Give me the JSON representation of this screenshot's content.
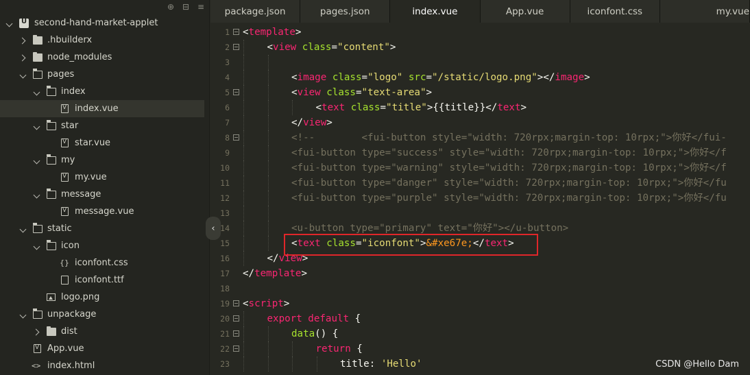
{
  "sidebar": {
    "toolbar": [
      {
        "name": "locate-icon",
        "glyph": "⊕"
      },
      {
        "name": "collapse-all-icon",
        "glyph": "⊟"
      },
      {
        "name": "menu-icon",
        "glyph": "≡"
      }
    ],
    "tree": [
      {
        "label": "second-hand-market-applet",
        "depth": 0,
        "kind": "project",
        "caret": "open"
      },
      {
        "label": ".hbuilderx",
        "depth": 1,
        "kind": "folder",
        "caret": "closed"
      },
      {
        "label": "node_modules",
        "depth": 1,
        "kind": "folder",
        "caret": "closed"
      },
      {
        "label": "pages",
        "depth": 1,
        "kind": "folder-open",
        "caret": "open"
      },
      {
        "label": "index",
        "depth": 2,
        "kind": "folder-open",
        "caret": "open"
      },
      {
        "label": "index.vue",
        "depth": 3,
        "kind": "vue",
        "caret": "none",
        "selected": true
      },
      {
        "label": "star",
        "depth": 2,
        "kind": "folder-open",
        "caret": "open"
      },
      {
        "label": "star.vue",
        "depth": 3,
        "kind": "vue",
        "caret": "none"
      },
      {
        "label": "my",
        "depth": 2,
        "kind": "folder-open",
        "caret": "open"
      },
      {
        "label": "my.vue",
        "depth": 3,
        "kind": "vue",
        "caret": "none"
      },
      {
        "label": "message",
        "depth": 2,
        "kind": "folder-open",
        "caret": "open"
      },
      {
        "label": "message.vue",
        "depth": 3,
        "kind": "vue",
        "caret": "none"
      },
      {
        "label": "static",
        "depth": 1,
        "kind": "folder-open",
        "caret": "open"
      },
      {
        "label": "icon",
        "depth": 2,
        "kind": "folder-open",
        "caret": "open"
      },
      {
        "label": "iconfont.css",
        "depth": 3,
        "kind": "css",
        "caret": "none"
      },
      {
        "label": "iconfont.ttf",
        "depth": 3,
        "kind": "plain",
        "caret": "none"
      },
      {
        "label": "logo.png",
        "depth": 2,
        "kind": "img",
        "caret": "none"
      },
      {
        "label": "unpackage",
        "depth": 1,
        "kind": "folder-open",
        "caret": "open"
      },
      {
        "label": "dist",
        "depth": 2,
        "kind": "folder",
        "caret": "closed"
      },
      {
        "label": "App.vue",
        "depth": 1,
        "kind": "vue",
        "caret": "none"
      },
      {
        "label": "index.html",
        "depth": 1,
        "kind": "html",
        "caret": "none"
      }
    ],
    "collapse_handle_glyph": "‹"
  },
  "tabs": [
    {
      "label": "package.json",
      "active": false
    },
    {
      "label": "pages.json",
      "active": false
    },
    {
      "label": "index.vue",
      "active": true
    },
    {
      "label": "App.vue",
      "active": false
    },
    {
      "label": "iconfont.css",
      "active": false
    },
    {
      "label": "my.vue",
      "active": false
    }
  ],
  "editor": {
    "lines": [
      {
        "n": "1",
        "fold": true,
        "indent": 0,
        "tokens": [
          [
            "t-punc",
            "<"
          ],
          [
            "t-tag",
            "template"
          ],
          [
            "t-punc",
            ">"
          ]
        ]
      },
      {
        "n": "2",
        "fold": true,
        "indent": 1,
        "tokens": [
          [
            "t-punc",
            "<"
          ],
          [
            "t-tag",
            "view"
          ],
          [
            "t-punc",
            " "
          ],
          [
            "t-attr",
            "class"
          ],
          [
            "t-punc",
            "="
          ],
          [
            "t-str",
            "\"content\""
          ],
          [
            "t-punc",
            ">"
          ]
        ]
      },
      {
        "n": "3",
        "fold": false,
        "indent": 2,
        "tokens": []
      },
      {
        "n": "4",
        "fold": false,
        "indent": 2,
        "tokens": [
          [
            "t-punc",
            "<"
          ],
          [
            "t-tag",
            "image"
          ],
          [
            "t-punc",
            " "
          ],
          [
            "t-attr",
            "class"
          ],
          [
            "t-punc",
            "="
          ],
          [
            "t-str",
            "\"logo\""
          ],
          [
            "t-punc",
            " "
          ],
          [
            "t-attr",
            "src"
          ],
          [
            "t-punc",
            "="
          ],
          [
            "t-str",
            "\"/static/logo.png\""
          ],
          [
            "t-punc",
            "></"
          ],
          [
            "t-tag",
            "image"
          ],
          [
            "t-punc",
            ">"
          ]
        ]
      },
      {
        "n": "5",
        "fold": true,
        "indent": 2,
        "tokens": [
          [
            "t-punc",
            "<"
          ],
          [
            "t-tag",
            "view"
          ],
          [
            "t-punc",
            " "
          ],
          [
            "t-attr",
            "class"
          ],
          [
            "t-punc",
            "="
          ],
          [
            "t-str",
            "\"text-area\""
          ],
          [
            "t-punc",
            ">"
          ]
        ]
      },
      {
        "n": "6",
        "fold": false,
        "indent": 3,
        "tokens": [
          [
            "t-punc",
            "<"
          ],
          [
            "t-tag",
            "text"
          ],
          [
            "t-punc",
            " "
          ],
          [
            "t-attr",
            "class"
          ],
          [
            "t-punc",
            "="
          ],
          [
            "t-str",
            "\"title\""
          ],
          [
            "t-punc",
            ">{{title}}</"
          ],
          [
            "t-tag",
            "text"
          ],
          [
            "t-punc",
            ">"
          ]
        ]
      },
      {
        "n": "7",
        "fold": false,
        "indent": 2,
        "tokens": [
          [
            "t-punc",
            "</"
          ],
          [
            "t-tag",
            "view"
          ],
          [
            "t-punc",
            ">"
          ]
        ]
      },
      {
        "n": "8",
        "fold": true,
        "indent": 2,
        "tokens": [
          [
            "t-comment",
            "<!--        <fui-button style=\"width: 720rpx;margin-top: 10rpx;\">你好</fui-"
          ]
        ]
      },
      {
        "n": "9",
        "fold": false,
        "indent": 2,
        "tokens": [
          [
            "t-comment",
            "<fui-button type=\"success\" style=\"width: 720rpx;margin-top: 10rpx;\">你好</f"
          ]
        ]
      },
      {
        "n": "10",
        "fold": false,
        "indent": 2,
        "tokens": [
          [
            "t-comment",
            "<fui-button type=\"warning\" style=\"width: 720rpx;margin-top: 10rpx;\">你好</f"
          ]
        ]
      },
      {
        "n": "11",
        "fold": false,
        "indent": 2,
        "tokens": [
          [
            "t-comment",
            "<fui-button type=\"danger\" style=\"width: 720rpx;margin-top: 10rpx;\">你好</fu"
          ]
        ]
      },
      {
        "n": "12",
        "fold": false,
        "indent": 2,
        "tokens": [
          [
            "t-comment",
            "<fui-button type=\"purple\" style=\"width: 720rpx;margin-top: 10rpx;\">你好</fu"
          ]
        ]
      },
      {
        "n": "13",
        "fold": false,
        "indent": 2,
        "tokens": []
      },
      {
        "n": "14",
        "fold": false,
        "indent": 2,
        "tokens": [
          [
            "t-comment",
            "<u-button type=\"primary\" text=\"你好\"></u-button>"
          ]
        ]
      },
      {
        "n": "15",
        "fold": false,
        "indent": 2,
        "tokens": [
          [
            "t-punc",
            "<"
          ],
          [
            "t-tag",
            "text"
          ],
          [
            "t-punc",
            " "
          ],
          [
            "t-attr",
            "class"
          ],
          [
            "t-punc",
            "="
          ],
          [
            "t-str",
            "\"iconfont\""
          ],
          [
            "t-punc",
            ">"
          ],
          [
            "t-ent",
            "&#xe67e;"
          ],
          [
            "t-punc",
            "</"
          ],
          [
            "t-tag",
            "text"
          ],
          [
            "t-punc",
            ">"
          ]
        ]
      },
      {
        "n": "16",
        "fold": false,
        "indent": 1,
        "tokens": [
          [
            "t-punc",
            "</"
          ],
          [
            "t-tag",
            "view"
          ],
          [
            "t-punc",
            ">"
          ]
        ]
      },
      {
        "n": "17",
        "fold": false,
        "indent": 0,
        "tokens": [
          [
            "t-punc",
            "</"
          ],
          [
            "t-tag",
            "template"
          ],
          [
            "t-punc",
            ">"
          ]
        ]
      },
      {
        "n": "18",
        "fold": false,
        "indent": 0,
        "tokens": []
      },
      {
        "n": "19",
        "fold": true,
        "indent": 0,
        "tokens": [
          [
            "t-punc",
            "<"
          ],
          [
            "t-tag",
            "script"
          ],
          [
            "t-punc",
            ">"
          ]
        ]
      },
      {
        "n": "20",
        "fold": true,
        "indent": 1,
        "tokens": [
          [
            "t-kw",
            "export"
          ],
          [
            "t-punc",
            " "
          ],
          [
            "t-kw",
            "default"
          ],
          [
            "t-punc",
            " {"
          ]
        ]
      },
      {
        "n": "21",
        "fold": true,
        "indent": 2,
        "tokens": [
          [
            "t-fn",
            "data"
          ],
          [
            "t-punc",
            "() {"
          ]
        ]
      },
      {
        "n": "22",
        "fold": true,
        "indent": 3,
        "tokens": [
          [
            "t-kw",
            "return"
          ],
          [
            "t-punc",
            " {"
          ]
        ]
      },
      {
        "n": "23",
        "fold": false,
        "indent": 4,
        "tokens": [
          [
            "t-prop",
            "title"
          ],
          [
            "t-punc",
            ": "
          ],
          [
            "t-str",
            "'Hello'"
          ]
        ]
      }
    ]
  },
  "watermark": "CSDN @Hello Dam"
}
